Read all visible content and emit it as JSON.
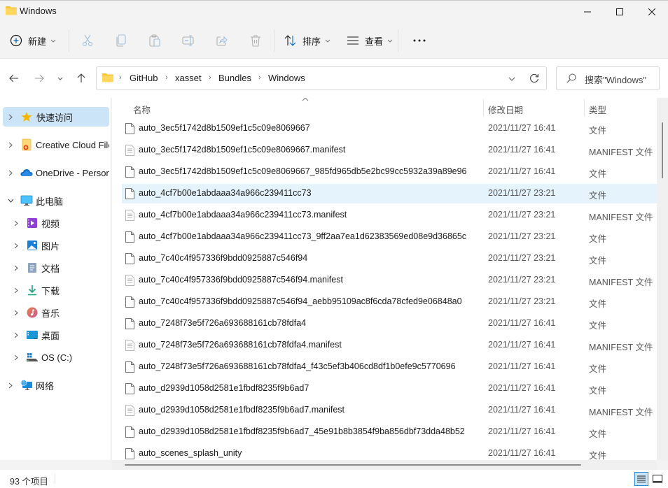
{
  "window": {
    "title": "Windows",
    "controls": {
      "minimize": "minimize-icon",
      "maximize": "maximize-icon",
      "close": "close-icon"
    }
  },
  "toolbar": {
    "new_label": "新建",
    "sort_label": "排序",
    "view_label": "查看",
    "icons": [
      "plus-circle-icon",
      "cut-icon",
      "copy-icon",
      "paste-icon",
      "rename-icon",
      "share-icon",
      "delete-icon",
      "sort-icon",
      "view-list-icon",
      "more-icon"
    ],
    "accent": "#0078d4"
  },
  "navigation": {
    "back": "back-arrow-icon",
    "forward": "forward-arrow-icon",
    "recent": "chevron-down-icon",
    "up": "up-arrow-icon",
    "breadcrumb": [
      "GitHub",
      "xasset",
      "Bundles",
      "Windows"
    ],
    "search_placeholder": "搜索\"Windows\""
  },
  "sidebar": {
    "items": [
      {
        "label": "快速访问",
        "icon": "star-icon",
        "expanded": false,
        "selected": true,
        "level": 0
      },
      {
        "label": "Creative Cloud Files",
        "icon": "creative-cloud-icon",
        "expanded": false,
        "selected": false,
        "level": 0
      },
      {
        "label": "OneDrive - Personal",
        "icon": "onedrive-icon",
        "expanded": false,
        "selected": false,
        "level": 0
      },
      {
        "label": "此电脑",
        "icon": "this-pc-icon",
        "expanded": true,
        "selected": false,
        "level": 0
      },
      {
        "label": "视频",
        "icon": "videos-icon",
        "expanded": false,
        "selected": false,
        "level": 1
      },
      {
        "label": "图片",
        "icon": "pictures-icon",
        "expanded": false,
        "selected": false,
        "level": 1
      },
      {
        "label": "文档",
        "icon": "documents-icon",
        "expanded": false,
        "selected": false,
        "level": 1
      },
      {
        "label": "下载",
        "icon": "downloads-icon",
        "expanded": false,
        "selected": false,
        "level": 1
      },
      {
        "label": "音乐",
        "icon": "music-icon",
        "expanded": false,
        "selected": false,
        "level": 1
      },
      {
        "label": "桌面",
        "icon": "desktop-icon",
        "expanded": false,
        "selected": false,
        "level": 1
      },
      {
        "label": "OS (C:)",
        "icon": "drive-icon",
        "expanded": false,
        "selected": false,
        "level": 1
      },
      {
        "label": "网络",
        "icon": "network-icon",
        "expanded": false,
        "selected": false,
        "level": 0
      }
    ]
  },
  "filelist": {
    "columns": {
      "name": "名称",
      "date": "修改日期",
      "type": "类型"
    },
    "sort_column": "name",
    "rows": [
      {
        "name": "auto_3ec5f1742d8b1509ef1c5c09e8069667",
        "date": "2021/11/27 16:41",
        "type": "文件",
        "icon": "file-icon",
        "selected": false
      },
      {
        "name": "auto_3ec5f1742d8b1509ef1c5c09e8069667.manifest",
        "date": "2021/11/27 16:41",
        "type": "MANIFEST 文件",
        "icon": "text-file-icon",
        "selected": false
      },
      {
        "name": "auto_3ec5f1742d8b1509ef1c5c09e8069667_985fd965db5e2bc99cc5932a39a89e96",
        "date": "2021/11/27 16:41",
        "type": "文件",
        "icon": "file-icon",
        "selected": false
      },
      {
        "name": "auto_4cf7b00e1abdaaa34a966c239411cc73",
        "date": "2021/11/27 23:21",
        "type": "文件",
        "icon": "file-icon",
        "selected": true
      },
      {
        "name": "auto_4cf7b00e1abdaaa34a966c239411cc73.manifest",
        "date": "2021/11/27 23:21",
        "type": "MANIFEST 文件",
        "icon": "text-file-icon",
        "selected": false
      },
      {
        "name": "auto_4cf7b00e1abdaaa34a966c239411cc73_9ff2aa7ea1d62383569ed08e9d36865c",
        "date": "2021/11/27 23:21",
        "type": "文件",
        "icon": "file-icon",
        "selected": false
      },
      {
        "name": "auto_7c40c4f957336f9bdd0925887c546f94",
        "date": "2021/11/27 23:21",
        "type": "文件",
        "icon": "file-icon",
        "selected": false
      },
      {
        "name": "auto_7c40c4f957336f9bdd0925887c546f94.manifest",
        "date": "2021/11/27 23:21",
        "type": "MANIFEST 文件",
        "icon": "text-file-icon",
        "selected": false
      },
      {
        "name": "auto_7c40c4f957336f9bdd0925887c546f94_aebb95109ac8f6cda78cfed9e06848a0",
        "date": "2021/11/27 23:21",
        "type": "文件",
        "icon": "file-icon",
        "selected": false
      },
      {
        "name": "auto_7248f73e5f726a693688161cb78fdfa4",
        "date": "2021/11/27 16:41",
        "type": "文件",
        "icon": "file-icon",
        "selected": false
      },
      {
        "name": "auto_7248f73e5f726a693688161cb78fdfa4.manifest",
        "date": "2021/11/27 16:41",
        "type": "MANIFEST 文件",
        "icon": "text-file-icon",
        "selected": false
      },
      {
        "name": "auto_7248f73e5f726a693688161cb78fdfa4_f43c5ef3b406cd8df1b0efe9c5770696",
        "date": "2021/11/27 16:41",
        "type": "文件",
        "icon": "file-icon",
        "selected": false
      },
      {
        "name": "auto_d2939d1058d2581e1fbdf8235f9b6ad7",
        "date": "2021/11/27 16:41",
        "type": "文件",
        "icon": "file-icon",
        "selected": false
      },
      {
        "name": "auto_d2939d1058d2581e1fbdf8235f9b6ad7.manifest",
        "date": "2021/11/27 16:41",
        "type": "MANIFEST 文件",
        "icon": "text-file-icon",
        "selected": false
      },
      {
        "name": "auto_d2939d1058d2581e1fbdf8235f9b6ad7_45e91b8b3854f9ba856dbf73dda48b52",
        "date": "2021/11/27 16:41",
        "type": "文件",
        "icon": "file-icon",
        "selected": false
      },
      {
        "name": "auto_scenes_splash_unity",
        "date": "2021/11/27 16:41",
        "type": "文件",
        "icon": "file-icon",
        "selected": false
      }
    ]
  },
  "statusbar": {
    "item_count": "93 个项目",
    "view_modes": [
      "details-view-icon",
      "tiles-view-icon"
    ],
    "active_view": "details"
  }
}
